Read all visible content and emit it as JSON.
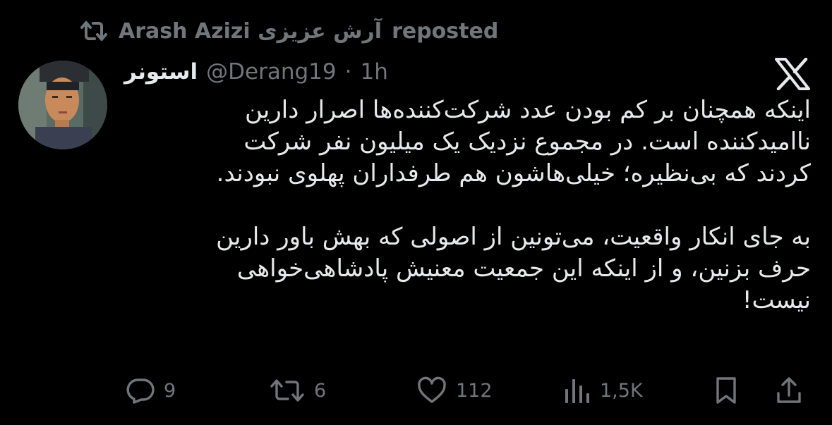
{
  "repost": {
    "icon": "repost-icon",
    "reposter_name": "Arash Azizi آرش عزیزی",
    "label": "reposted"
  },
  "author": {
    "avatar_icon": "portrait-avatar",
    "display_name": "استونر",
    "handle": "@Derang19",
    "separator": "·",
    "time": "1h"
  },
  "platform_logo": "x-logo-icon",
  "tweet": {
    "paragraphs": [
      "اینکه همچنان بر کم بودن عدد شرکت‌کننده‌ها اصرار دارین\nناامیدکننده است. در مجموع نزدیک یک میلیون نفر شرکت\nکردند که بی‌نظیره؛ خیلی‌هاشون هم طرفداران پهلوی نبودند.",
      "به جای انکار واقعیت، می‌تونین از اصولی که بهش باور دارین\nحرف بزنین، و از اینکه این جمعیت معنیش پادشاهی‌خواهی\nنیست!"
    ]
  },
  "actions": {
    "reply": {
      "icon": "reply-icon",
      "count": "9"
    },
    "repost": {
      "icon": "repost-icon",
      "count": "6"
    },
    "like": {
      "icon": "heart-icon",
      "count": "112"
    },
    "views": {
      "icon": "views-chart-icon",
      "count": "1,5K"
    },
    "bookmark": {
      "icon": "bookmark-icon"
    },
    "share": {
      "icon": "share-icon"
    }
  },
  "colors": {
    "background": "#000000",
    "primary_text": "#e7e9ea",
    "secondary_text": "#71767b"
  }
}
